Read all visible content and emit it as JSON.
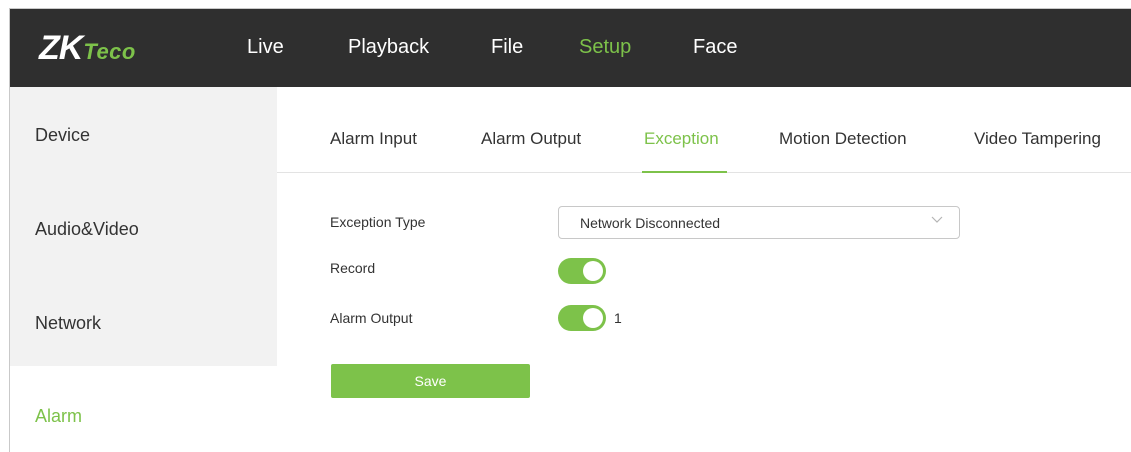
{
  "header": {
    "logo": {
      "main": "ZK",
      "accent": "Teco"
    },
    "nav": [
      {
        "label": "Live"
      },
      {
        "label": "Playback"
      },
      {
        "label": "File"
      },
      {
        "label": "Setup",
        "active": true
      },
      {
        "label": "Face"
      }
    ]
  },
  "sidebar": {
    "items": [
      {
        "label": "Device"
      },
      {
        "label": "Audio&Video"
      },
      {
        "label": "Network"
      },
      {
        "label": "Alarm",
        "active": true
      }
    ]
  },
  "tabs": [
    {
      "label": "Alarm Input"
    },
    {
      "label": "Alarm Output"
    },
    {
      "label": "Exception",
      "active": true
    },
    {
      "label": "Motion Detection"
    },
    {
      "label": "Video Tampering"
    }
  ],
  "form": {
    "exception_type": {
      "label": "Exception Type",
      "value": "Network Disconnected"
    },
    "record": {
      "label": "Record",
      "enabled": true
    },
    "alarm_output": {
      "label": "Alarm Output",
      "enabled": true,
      "channel": "1"
    },
    "save_label": "Save"
  },
  "colors": {
    "accent": "#7dc24a",
    "header_bg": "#2f2f2f",
    "sidebar_bg": "#f2f2f2"
  }
}
